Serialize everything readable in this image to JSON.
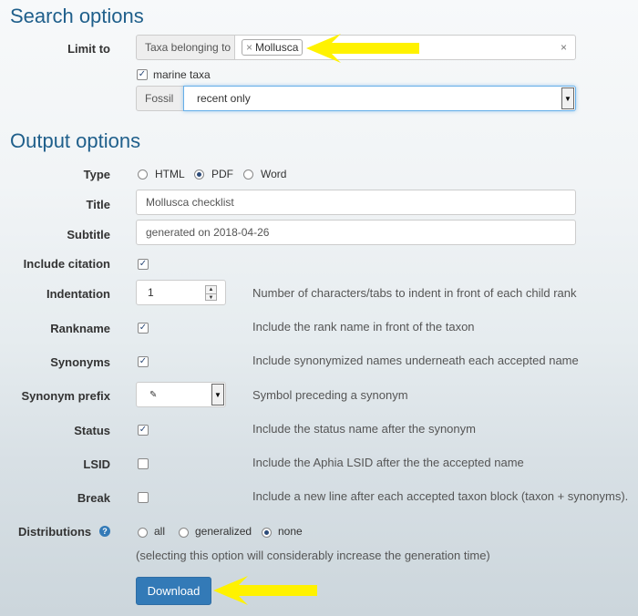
{
  "search": {
    "heading": "Search options",
    "limit_label": "Limit to",
    "taxa_addon": "Taxa belonging to",
    "taxa_tag": "Mollusca",
    "tag_remove": "×",
    "clear_symbol": "×",
    "marine_label": "marine taxa",
    "fossil_addon": "Fossil",
    "fossil_value": "recent only"
  },
  "output": {
    "heading": "Output options",
    "type_label": "Type",
    "type_options": [
      "HTML",
      "PDF",
      "Word"
    ],
    "type_selected": "PDF",
    "title_label": "Title",
    "title_value": "Mollusca checklist",
    "subtitle_label": "Subtitle",
    "subtitle_value": "generated on 2018-04-26",
    "citation_label": "Include citation",
    "indent_label": "Indentation",
    "indent_value": "1",
    "indent_help": "Number of characters/tabs to indent in front of each child rank",
    "rankname_label": "Rankname",
    "rankname_help": "Include the rank name in front of the taxon",
    "synonyms_label": "Synonyms",
    "synonyms_help": "Include synonymized names underneath each accepted name",
    "synprefix_label": "Synonym prefix",
    "synprefix_value": "✎",
    "synprefix_help": "Symbol preceding a synonym",
    "status_label": "Status",
    "status_help": "Include the status name after the synonym",
    "lsid_label": "LSID",
    "lsid_help": "Include the Aphia LSID after the the accepted name",
    "break_label": "Break",
    "break_help": "Include a new line after each accepted taxon block (taxon + synonyms).",
    "dist_label": "Distributions",
    "dist_options": [
      "all",
      "generalized",
      "none"
    ],
    "dist_selected": "none",
    "dist_note": "(selecting this option will considerably increase the generation time)",
    "download_label": "Download"
  },
  "checkboxes": {
    "marine": true,
    "citation": true,
    "rankname": true,
    "synonyms": true,
    "status": true,
    "lsid": false,
    "break": false
  },
  "colors": {
    "heading": "#1f5f8b",
    "button": "#337ab7",
    "arrow": "#fff200"
  }
}
